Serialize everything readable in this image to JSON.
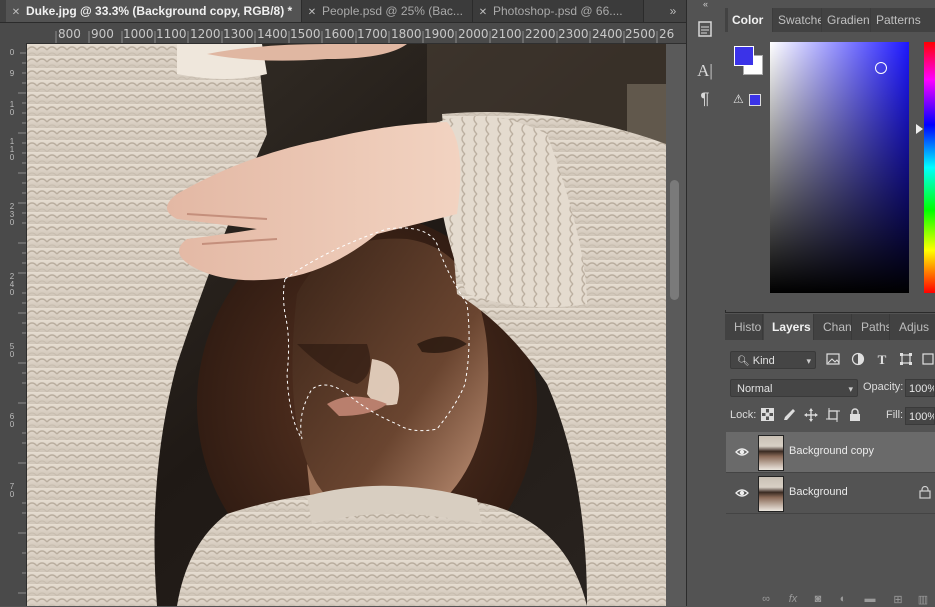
{
  "document_tabs": [
    {
      "label": "Duke.jpg @ 33.3% (Background copy, RGB/8) *",
      "active": true
    },
    {
      "label": "People.psd @ 25% (Bac...",
      "active": false
    },
    {
      "label": "Photoshop-.psd @ 66....",
      "active": false
    }
  ],
  "ruler": {
    "top_labels": [
      "800",
      "900",
      "1000",
      "1100",
      "1200",
      "1300",
      "1400",
      "1500",
      "1600",
      "1700",
      "1800",
      "1900",
      "2000",
      "2100",
      "2200",
      "2300",
      "2400",
      "2500",
      "26"
    ],
    "left_labels": [
      "0",
      "9",
      "1",
      "0",
      "1",
      "1",
      "0",
      "2",
      "3",
      "0",
      "2",
      "4",
      "0",
      "5",
      "0",
      "6",
      "0",
      "7",
      "0"
    ]
  },
  "color_panel": {
    "tabs": [
      "Color",
      "Swatche",
      "Gradien",
      "Patterns"
    ],
    "foreground_color": "#3b33e8",
    "background_color": "#ffffff"
  },
  "layers_panel": {
    "tabs": [
      "Histo",
      "Layers",
      "Chan",
      "Paths",
      "Adjus"
    ],
    "filter_kind": "Kind",
    "blend_mode": "Normal",
    "opacity_label": "Opacity:",
    "opacity_value": "100%",
    "lock_label": "Lock:",
    "fill_label": "Fill:",
    "fill_value": "100%",
    "layers": [
      {
        "name": "Background copy",
        "selected": true,
        "locked": false
      },
      {
        "name": "Background",
        "selected": false,
        "locked": true
      }
    ]
  },
  "icons": {
    "dock": [
      "panel-icon",
      "character-icon",
      "paragraph-icon"
    ]
  }
}
